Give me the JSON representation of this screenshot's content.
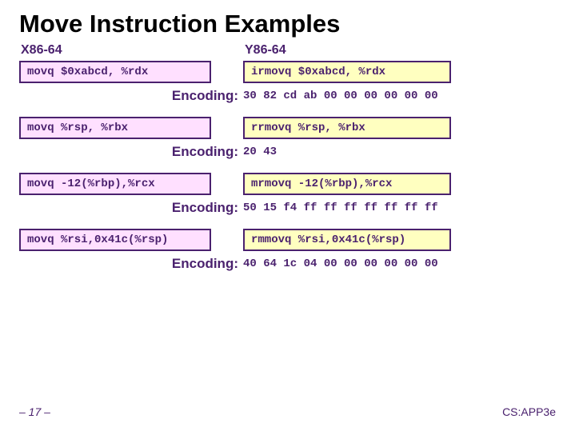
{
  "title": "Move Instruction Examples",
  "headers": {
    "x": "X86-64",
    "y": "Y86-64"
  },
  "rows": [
    {
      "x": "movq $0xabcd, %rdx",
      "y": "irmovq $0xabcd, %rdx",
      "enc_label": "Encoding:",
      "enc": "30 82 cd ab 00 00 00 00 00 00"
    },
    {
      "x": "movq %rsp, %rbx",
      "y": "rrmovq %rsp, %rbx",
      "enc_label": "Encoding:",
      "enc": "20 43"
    },
    {
      "x": "movq -12(%rbp),%rcx",
      "y": "mrmovq -12(%rbp),%rcx",
      "enc_label": "Encoding:",
      "enc": "50 15 f4 ff ff ff ff ff ff ff"
    },
    {
      "x": "movq %rsi,0x41c(%rsp)",
      "y": "rmmovq %rsi,0x41c(%rsp)",
      "enc_label": "Encoding:",
      "enc": "40 64 1c 04 00 00 00 00 00 00"
    }
  ],
  "footer": {
    "page": "– 17 –",
    "source": "CS:APP3e"
  }
}
